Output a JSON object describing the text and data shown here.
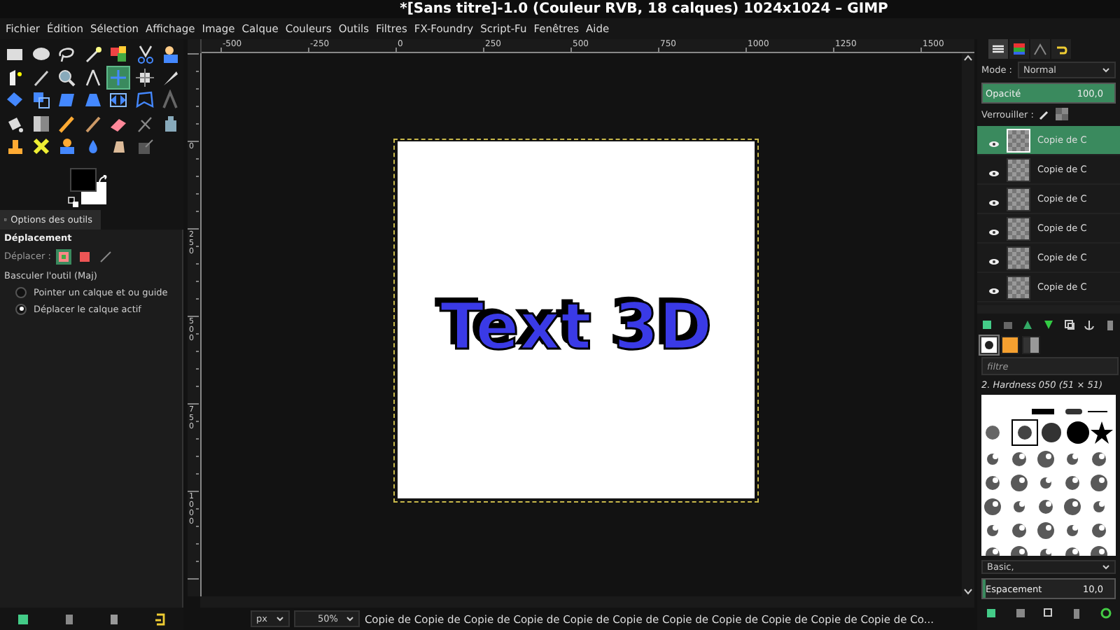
{
  "window": {
    "title": "*[Sans titre]-1.0 (Couleur RVB, 18 calques) 1024x1024 – GIMP"
  },
  "menu": [
    "Fichier",
    "Édition",
    "Sélection",
    "Affichage",
    "Image",
    "Calque",
    "Couleurs",
    "Outils",
    "Filtres",
    "FX-Foundry",
    "Script-Fu",
    "Fenêtres",
    "Aide"
  ],
  "toolbox": {
    "tools": [
      {
        "selected": false
      },
      {
        "selected": false
      },
      {
        "selected": false
      },
      {
        "selected": false
      },
      {
        "selected": false
      },
      {
        "selected": false
      },
      {
        "selected": false
      },
      {
        "selected": false
      },
      {
        "selected": false
      },
      {
        "selected": false
      },
      {
        "selected": false
      },
      {
        "selected": true
      },
      {
        "selected": false
      },
      {
        "selected": false
      },
      {
        "selected": false
      },
      {
        "selected": false
      },
      {
        "selected": false
      },
      {
        "selected": false
      },
      {
        "selected": false
      },
      {
        "selected": false
      },
      {
        "selected": false
      },
      {
        "selected": false
      },
      {
        "selected": false
      },
      {
        "selected": false
      },
      {
        "selected": false
      },
      {
        "selected": false
      },
      {
        "selected": false
      },
      {
        "selected": false
      },
      {
        "selected": false
      },
      {
        "selected": false
      },
      {
        "selected": false
      },
      {
        "selected": false
      },
      {
        "selected": false
      },
      {
        "selected": false
      }
    ]
  },
  "tool_options": {
    "tab": "Options des outils",
    "tool": "Déplacement",
    "move_label": "Déplacer :",
    "move_targets": [
      {
        "selected": true
      },
      {
        "selected": false
      },
      {
        "selected": false
      }
    ],
    "toggle_label": "Basculer l'outil  (Maj)",
    "options": [
      {
        "label": "Pointer un calque et ou guide",
        "selected": false
      },
      {
        "label": "Déplacer le calque actif",
        "selected": true
      }
    ]
  },
  "canvas": {
    "top_ruler": [
      "-500",
      "-250",
      "0",
      "250",
      "500",
      "750",
      "1000",
      "1250",
      "1500"
    ],
    "left_ruler": [
      "0",
      "250",
      "500",
      "750",
      "1000"
    ],
    "image_text": "Text 3D"
  },
  "status_bar": {
    "unit": "px",
    "zoom": "50%",
    "message": "Copie de Copie de Copie de Copie de Copie de Copie de Copie de Copie de Copie de Copie de Copie de Co..."
  },
  "dock_tabs": [
    {
      "selected": true
    },
    {
      "selected": false
    },
    {
      "selected": false
    },
    {
      "selected": false
    }
  ],
  "layers_panel": {
    "mode_label": "Mode :",
    "mode": "Normal",
    "opacity": {
      "label": "Opacité",
      "value": "100,0",
      "level": 1.0
    },
    "lock_label": "Verrouiller :",
    "layers": [
      {
        "name": "Copie de C",
        "visible": true,
        "selected": true
      },
      {
        "name": "Copie de C",
        "visible": true,
        "selected": false
      },
      {
        "name": "Copie de C",
        "visible": true,
        "selected": false
      },
      {
        "name": "Copie de C",
        "visible": true,
        "selected": false
      },
      {
        "name": "Copie de C",
        "visible": true,
        "selected": false
      },
      {
        "name": "Copie de C",
        "visible": true,
        "selected": false
      }
    ]
  },
  "brushes_panel": {
    "tabs": [
      {
        "selected": true
      },
      {
        "selected": false
      },
      {
        "selected": false
      }
    ],
    "filter_placeholder": "filtre",
    "brush_name": "2. Hardness 050 (51 × 51)",
    "preset": "Basic,",
    "spacing": {
      "label": "Espacement",
      "value": "10,0",
      "level": 0.02
    }
  }
}
